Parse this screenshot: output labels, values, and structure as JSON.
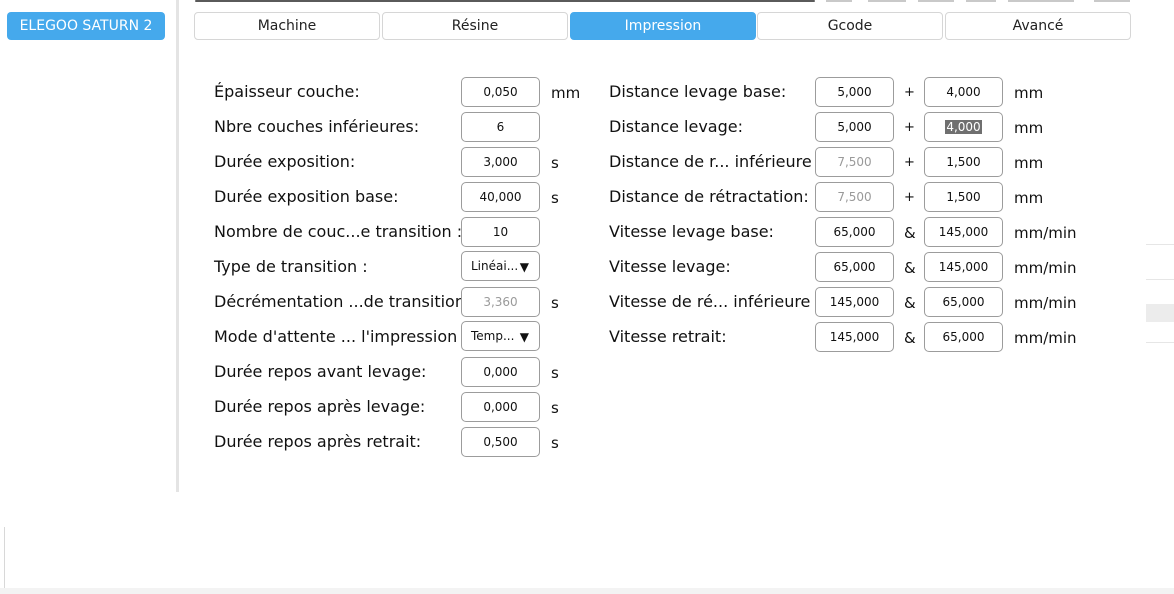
{
  "sidebar": {
    "printer_label": "ELEGOO SATURN 2"
  },
  "tabs": [
    {
      "label": "Machine",
      "active": false
    },
    {
      "label": "Résine",
      "active": false
    },
    {
      "label": "Impression",
      "active": true
    },
    {
      "label": "Gcode",
      "active": false
    },
    {
      "label": "Avancé",
      "active": false
    }
  ],
  "left_fields": [
    {
      "label": "Épaisseur couche:",
      "value": "0,050",
      "unit": "mm"
    },
    {
      "label": "Nbre couches inférieures:",
      "value": "6",
      "unit": ""
    },
    {
      "label": "Durée exposition:",
      "value": "3,000",
      "unit": "s"
    },
    {
      "label": "Durée exposition base:",
      "value": "40,000",
      "unit": "s"
    },
    {
      "label": "Nombre de couc...e transition :",
      "value": "10",
      "unit": ""
    },
    {
      "label": "Type de transition :",
      "value": "Linéai...",
      "unit": ""
    },
    {
      "label": "Décrémentation ...de transition :",
      "value": "3,360",
      "unit": "s"
    },
    {
      "label": "Mode d'attente ... l'impression :",
      "value": "Temp...",
      "unit": ""
    },
    {
      "label": "Durée repos avant levage:",
      "value": "0,000",
      "unit": "s"
    },
    {
      "label": "Durée repos après levage:",
      "value": "0,000",
      "unit": "s"
    },
    {
      "label": "Durée repos après retrait:",
      "value": "0,500",
      "unit": "s"
    }
  ],
  "right_fields": [
    {
      "label": "Distance levage base:",
      "value1": "5,000",
      "op": "+",
      "value2": "4,000",
      "unit": "mm"
    },
    {
      "label": "Distance levage:",
      "value1": "5,000",
      "op": "+",
      "value2": "4,000",
      "unit": "mm"
    },
    {
      "label": "Distance de r... inférieure :",
      "value1": "7,500",
      "op": "+",
      "value2": "1,500",
      "unit": "mm"
    },
    {
      "label": "Distance de rétractation:",
      "value1": "7,500",
      "op": "+",
      "value2": "1,500",
      "unit": "mm"
    },
    {
      "label": "Vitesse levage base:",
      "value1": "65,000",
      "op": "&",
      "value2": "145,000",
      "unit": "mm/min"
    },
    {
      "label": "Vitesse levage:",
      "value1": "65,000",
      "op": "&",
      "value2": "145,000",
      "unit": "mm/min"
    },
    {
      "label": "Vitesse de ré... inférieure :",
      "value1": "145,000",
      "op": "&",
      "value2": "65,000",
      "unit": "mm/min"
    },
    {
      "label": "Vitesse retrait:",
      "value1": "145,000",
      "op": "&",
      "value2": "65,000",
      "unit": "mm/min"
    }
  ],
  "icons": {
    "dropdown_caret": "▼",
    "dropdown_caret_name": "caret-down-icon"
  },
  "colors": {
    "accent": "#45a9ec",
    "selection": "#6f6f6f",
    "disabled_text": "#9a9a9a"
  }
}
